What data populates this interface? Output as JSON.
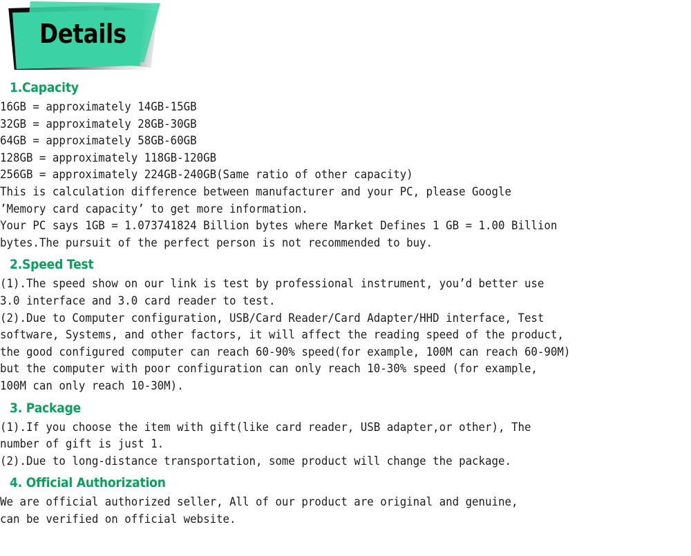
{
  "banner": {
    "title": "Details",
    "teal_color": "#3bd3a4",
    "shadow_color": "#0a0a0a"
  },
  "heading_color": "#0aa15c",
  "sections": [
    {
      "heading": "1.Capacity",
      "lines": [
        "16GB = approximately 14GB-15GB",
        "32GB = approximately 28GB-30GB",
        "64GB = approximately 58GB-60GB",
        "128GB = approximately 118GB-120GB",
        "256GB = approximately 224GB-240GB(Same ratio of other capacity)",
        "This is calculation difference between manufacturer and your PC, please Google",
        "’Memory card capacity’ to get more information.",
        "Your PC says 1GB = 1.073741824 Billion bytes where Market Defines 1 GB = 1.00 Billion",
        "bytes.The pursuit of the perfect person is not recommended to buy."
      ]
    },
    {
      "heading": "2.Speed Test",
      "lines": [
        "(1).The speed show on our link is test by professional instrument, you’d better use",
        "3.0 interface and 3.0 card reader to test.",
        "(2).Due to Computer configuration, USB/Card Reader/Card Adapter/HHD interface, Test",
        "software, Systems, and other factors, it will affect the reading speed of the product,",
        "the good configured computer can reach 60-90% speed(for example, 100M can reach 60-90M)",
        "but the computer with poor configuration can only reach 10-30% speed (for example,",
        "100M can only reach 10-30M)."
      ]
    },
    {
      "heading": "3. Package",
      "lines": [
        "(1).If you choose the item with gift(like card reader, USB adapter,or other), The",
        "number of gift is just 1.",
        "(2).Due to long-distance transportation, some product will change the package."
      ]
    },
    {
      "heading": "4. Official Authorization",
      "lines": [
        "We are official authorized seller, All of our product are original and genuine,",
        "can be verified on official website."
      ]
    }
  ]
}
